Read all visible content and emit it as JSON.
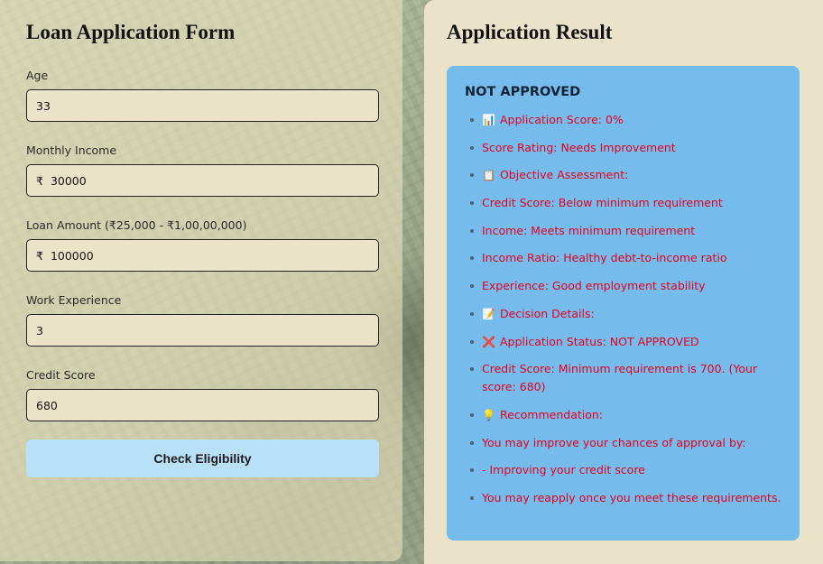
{
  "form": {
    "title": "Loan Application Form",
    "fields": [
      {
        "label": "Age",
        "prefix": "",
        "value": "33"
      },
      {
        "label": "Monthly Income",
        "prefix": "₹",
        "value": "30000"
      },
      {
        "label": "Loan Amount (₹25,000 - ₹1,00,00,000)",
        "prefix": "₹",
        "value": "100000"
      },
      {
        "label": "Work Experience",
        "prefix": "",
        "value": "3"
      },
      {
        "label": "Credit Score",
        "prefix": "",
        "value": "680"
      }
    ],
    "submit_label": "Check Eligibility"
  },
  "result": {
    "title": "Application Result",
    "status": "NOT APPROVED",
    "items": [
      {
        "icon": "📊",
        "icon_name": "chart-icon",
        "text": "Application Score: 0%"
      },
      {
        "icon": "",
        "icon_name": "",
        "text": "Score Rating: Needs Improvement"
      },
      {
        "icon": "📋",
        "icon_name": "clipboard-icon",
        "text": "Objective Assessment:"
      },
      {
        "icon": "",
        "icon_name": "",
        "text": "Credit Score: Below minimum requirement"
      },
      {
        "icon": "",
        "icon_name": "",
        "text": "Income: Meets minimum requirement"
      },
      {
        "icon": "",
        "icon_name": "",
        "text": "Income Ratio: Healthy debt-to-income ratio"
      },
      {
        "icon": "",
        "icon_name": "",
        "text": "Experience: Good employment stability"
      },
      {
        "icon": "📝",
        "icon_name": "memo-icon",
        "text": "Decision Details:"
      },
      {
        "icon": "❌",
        "icon_name": "cross-mark-icon",
        "text": "Application Status: NOT APPROVED"
      },
      {
        "icon": "",
        "icon_name": "",
        "text": "Credit Score: Minimum requirement is 700. (Your score: 680)"
      },
      {
        "icon": "💡",
        "icon_name": "light-bulb-icon",
        "text": "Recommendation:"
      },
      {
        "icon": "",
        "icon_name": "",
        "text": "You may improve your chances of approval by:"
      },
      {
        "icon": "",
        "icon_name": "",
        "text": "- Improving your credit score"
      },
      {
        "icon": "",
        "icon_name": "",
        "text": "You may reapply once you meet these requirements."
      }
    ]
  },
  "colors": {
    "result_card": "#75bcec",
    "result_text": "#e8001d",
    "button": "#b9e0f9",
    "panel": "#ebe3c9"
  }
}
